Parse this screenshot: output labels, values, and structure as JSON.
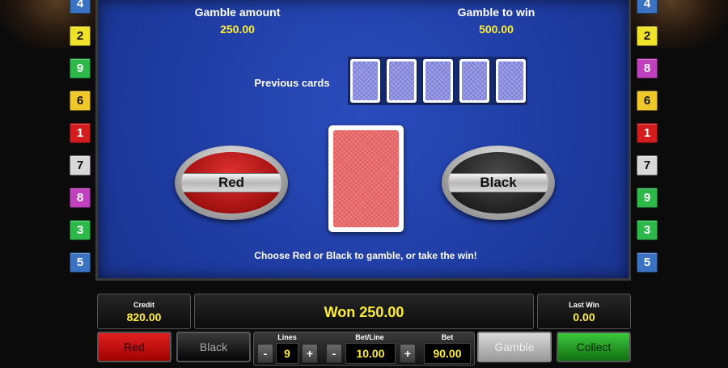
{
  "line_indicators": {
    "left": [
      {
        "num": "4",
        "color": "#3b73c4"
      },
      {
        "num": "2",
        "color": "#f0e22a"
      },
      {
        "num": "9",
        "color": "#2db84a"
      },
      {
        "num": "6",
        "color": "#f0c72a"
      },
      {
        "num": "1",
        "color": "#d31d1d"
      },
      {
        "num": "7",
        "color": "#d8d8d8"
      },
      {
        "num": "8",
        "color": "#c040c0"
      },
      {
        "num": "3",
        "color": "#2db84a"
      },
      {
        "num": "5",
        "color": "#3b73c4"
      }
    ],
    "right": [
      {
        "num": "4",
        "color": "#3b73c4"
      },
      {
        "num": "2",
        "color": "#f0e22a"
      },
      {
        "num": "8",
        "color": "#c040c0"
      },
      {
        "num": "6",
        "color": "#f0c72a"
      },
      {
        "num": "1",
        "color": "#d31d1d"
      },
      {
        "num": "7",
        "color": "#d8d8d8"
      },
      {
        "num": "9",
        "color": "#2db84a"
      },
      {
        "num": "3",
        "color": "#2db84a"
      },
      {
        "num": "5",
        "color": "#3b73c4"
      }
    ]
  },
  "gamble": {
    "amount_label": "Gamble amount",
    "amount_value": "250.00",
    "to_win_label": "Gamble to win",
    "to_win_value": "500.00",
    "previous_cards_label": "Previous cards",
    "previous_cards_count": 5,
    "red_label": "Red",
    "black_label": "Black",
    "instruction": "Choose Red or Black to gamble, or take the win!"
  },
  "bottom": {
    "credit_label": "Credit",
    "credit_value": "820.00",
    "message": "Won 250.00",
    "last_win_label": "Last Win",
    "last_win_value": "0.00",
    "red_button": "Red",
    "black_button": "Black",
    "lines_label": "Lines",
    "lines_value": "9",
    "betline_label": "Bet/Line",
    "betline_value": "10.00",
    "bet_label": "Bet",
    "bet_value": "90.00",
    "minus": "-",
    "plus": "+",
    "gamble_button": "Gamble",
    "collect_button": "Collect"
  },
  "colors": {
    "table_felt": "#1f3fa8",
    "value_yellow": "#ffee33"
  }
}
